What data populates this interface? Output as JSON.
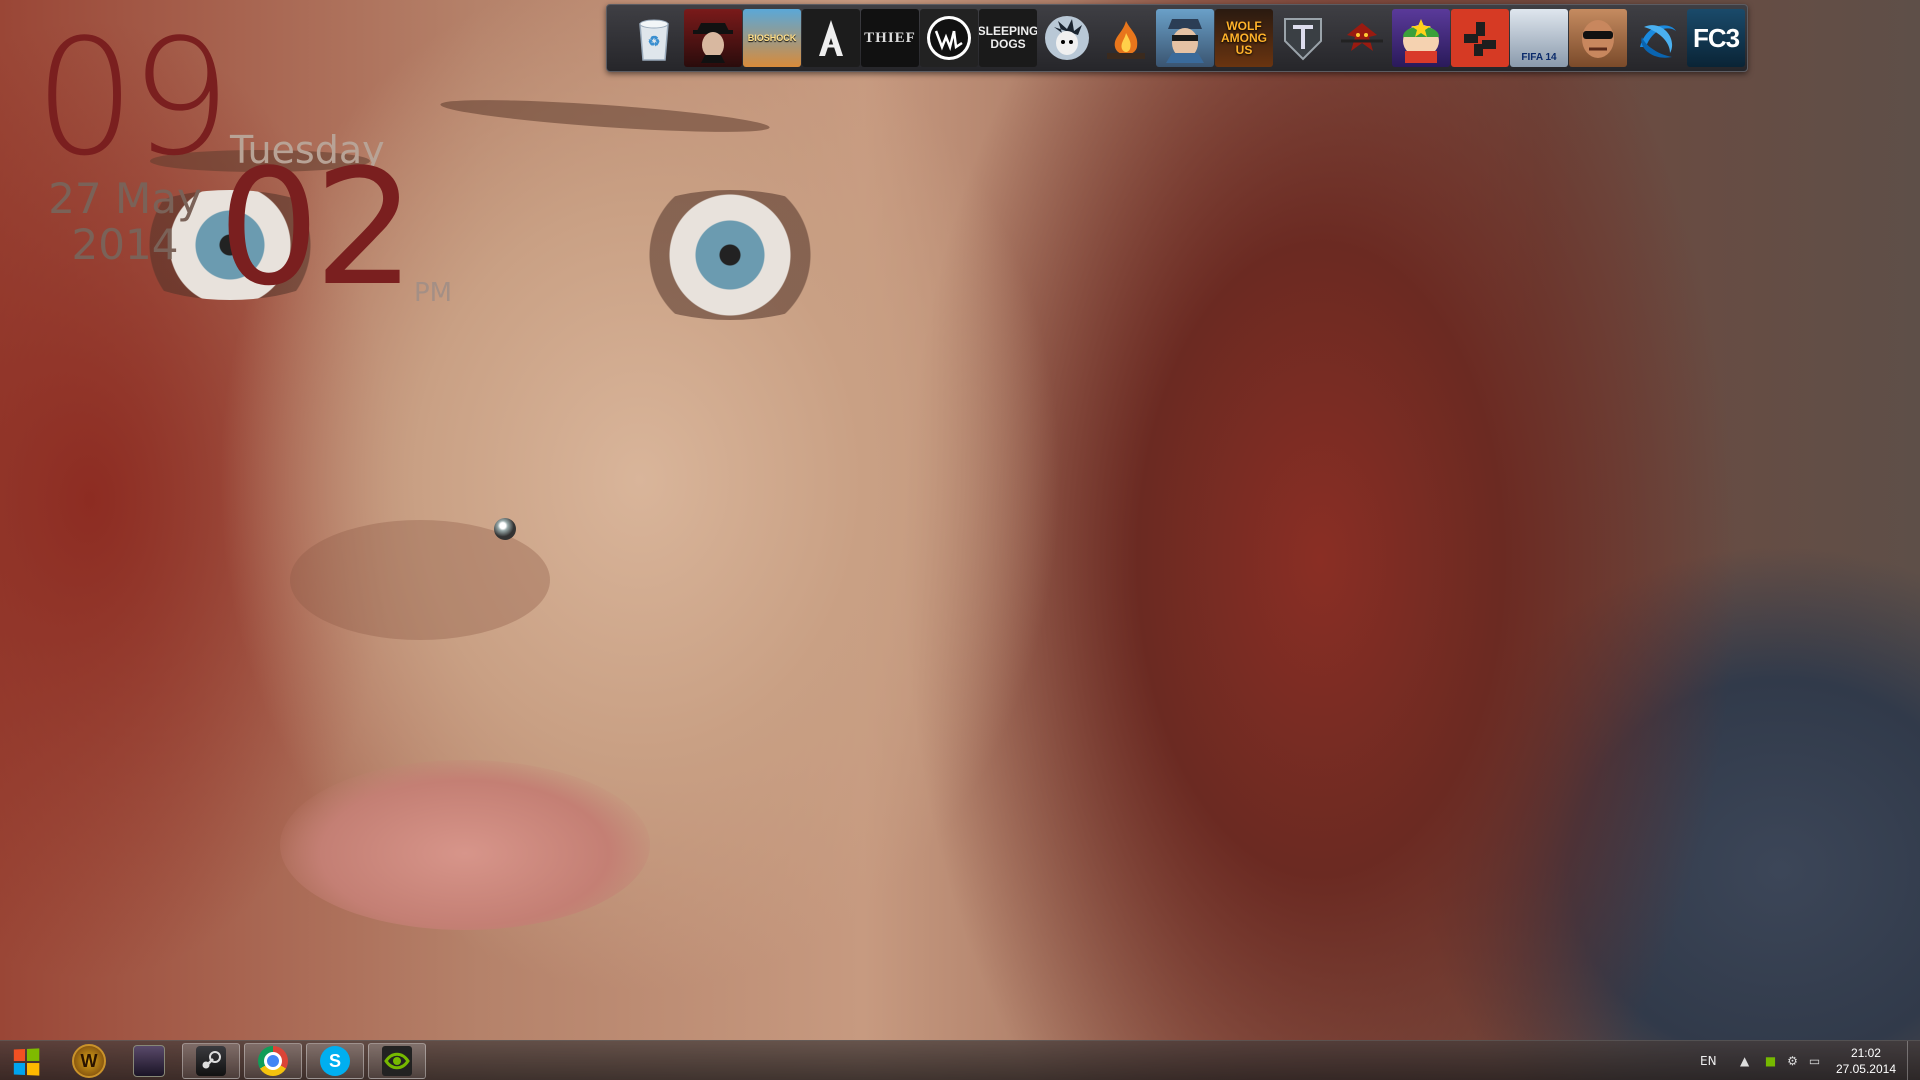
{
  "clock": {
    "hour": "09",
    "minute": "02",
    "day_name": "Tuesday",
    "date_line1": "27 May",
    "date_line2": "2014",
    "ampm": "PM"
  },
  "dock": {
    "items": [
      {
        "name": "recycle-bin",
        "label": "",
        "icon": "recycle-bin-icon"
      },
      {
        "name": "mafia",
        "label": "",
        "icon": "mafia-icon"
      },
      {
        "name": "bioshock",
        "label": "BIOSHOCK",
        "icon": "bioshock-icon"
      },
      {
        "name": "assassins-creed",
        "label": "",
        "icon": "assassins-creed-icon"
      },
      {
        "name": "thief",
        "label": "THIEF",
        "icon": "thief-icon"
      },
      {
        "name": "watch-dogs",
        "label": "",
        "icon": "watch-dogs-icon"
      },
      {
        "name": "sleeping-dogs",
        "label": "SLEEPING DOGS",
        "icon": "sleeping-dogs-icon"
      },
      {
        "name": "dont-starve",
        "label": "",
        "icon": "dont-starve-icon"
      },
      {
        "name": "dark-souls",
        "label": "",
        "icon": "dark-souls-icon"
      },
      {
        "name": "borderlands",
        "label": "",
        "icon": "borderlands-icon"
      },
      {
        "name": "wolf-among-us",
        "label": "WOLF AMONG US",
        "icon": "wolf-among-us-icon"
      },
      {
        "name": "world-of-tanks",
        "label": "",
        "icon": "world-of-tanks-icon"
      },
      {
        "name": "witcher",
        "label": "",
        "icon": "witcher-icon"
      },
      {
        "name": "south-park",
        "label": "",
        "icon": "south-park-icon"
      },
      {
        "name": "rust",
        "label": "",
        "icon": "rust-icon"
      },
      {
        "name": "fifa-14",
        "label": "FIFA 14",
        "icon": "fifa-icon"
      },
      {
        "name": "gta",
        "label": "",
        "icon": "gta-icon"
      },
      {
        "name": "battlenet",
        "label": "",
        "icon": "battlenet-icon"
      },
      {
        "name": "far-cry-3",
        "label": "FC3",
        "icon": "far-cry-3-icon"
      }
    ]
  },
  "taskbar": {
    "start_icon": "windows-logo-icon",
    "buttons": [
      {
        "name": "world-of-warcraft",
        "icon": "wow-icon",
        "glyph": "W",
        "active": false
      },
      {
        "name": "game-launcher",
        "icon": "game-launcher-icon",
        "glyph": "",
        "active": false
      },
      {
        "name": "steam",
        "icon": "steam-icon",
        "glyph": "",
        "active": true
      },
      {
        "name": "chrome",
        "icon": "chrome-icon",
        "glyph": "",
        "active": true
      },
      {
        "name": "skype",
        "icon": "skype-icon",
        "glyph": "S",
        "active": true
      },
      {
        "name": "nvidia",
        "icon": "nvidia-icon",
        "glyph": "",
        "active": true
      }
    ],
    "tray": {
      "language": "EN",
      "time": "21:02",
      "date": "27.05.2014"
    }
  },
  "colors": {
    "clock_digits": "#7a1f1f",
    "taskbar": "#3a3230"
  }
}
